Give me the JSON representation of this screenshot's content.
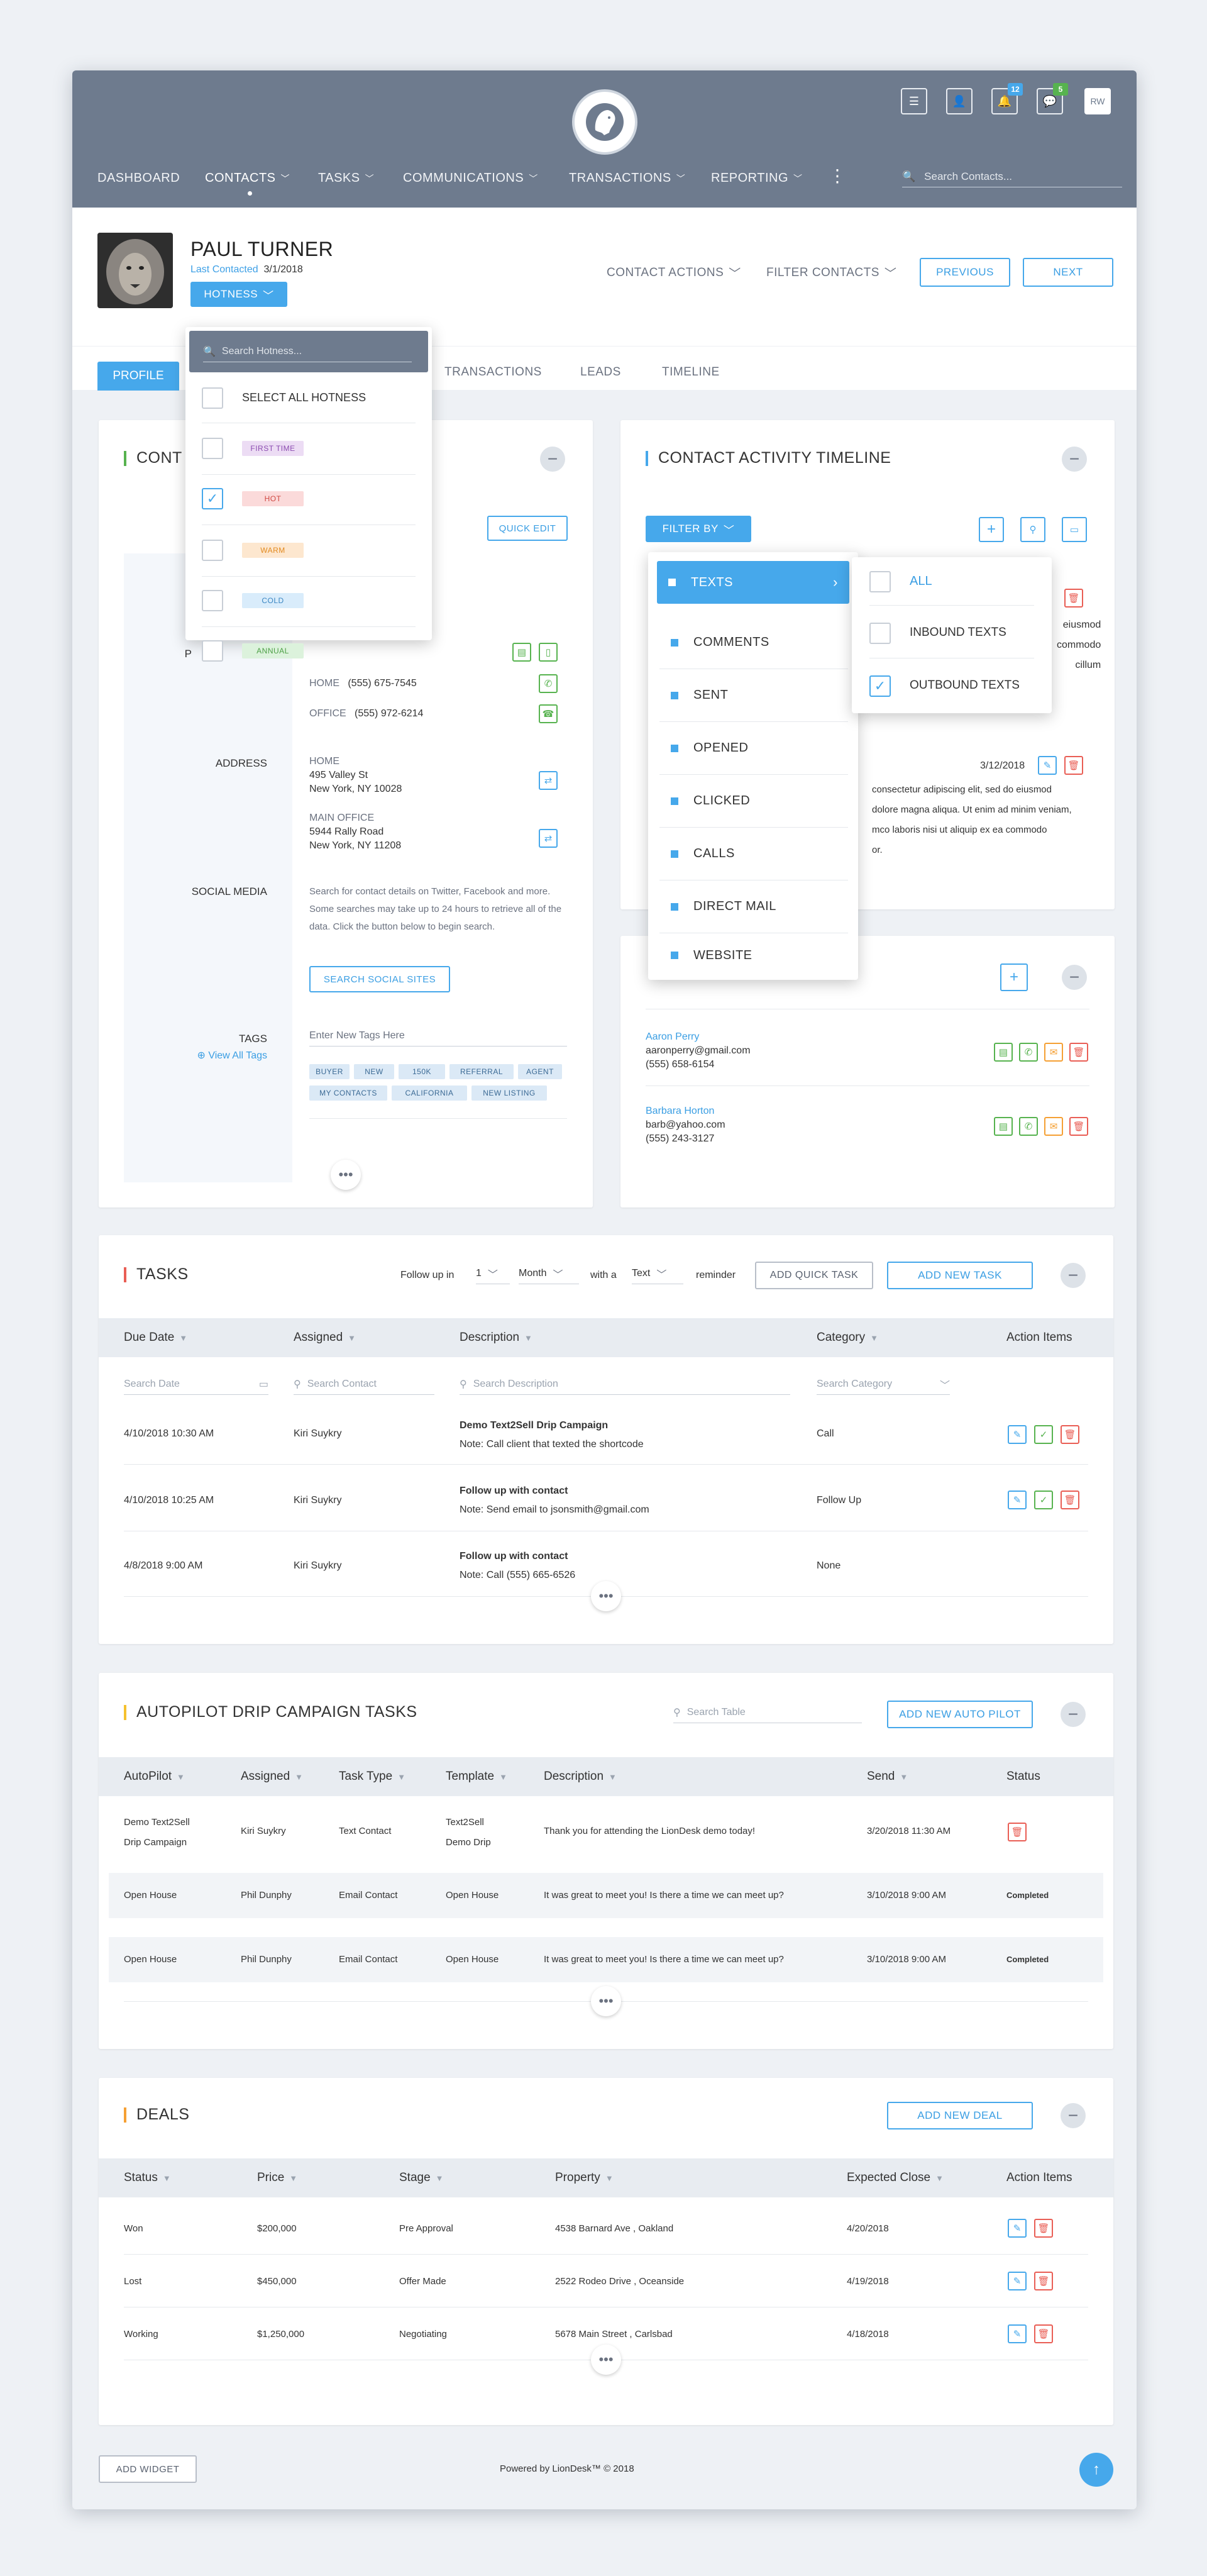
{
  "topbar": {
    "nav": [
      {
        "label": "DASHBOARD"
      },
      {
        "label": "CONTACTS"
      },
      {
        "label": "TASKS"
      },
      {
        "label": "COMMUNICATIONS"
      },
      {
        "label": "TRANSACTIONS"
      },
      {
        "label": "REPORTING"
      }
    ],
    "search_placeholder": "Search Contacts...",
    "notifications_count": "12",
    "messages_count": "5",
    "user_initials": "RW"
  },
  "contact": {
    "name": "PAUL TURNER",
    "last_contacted_label": "Last Contacted",
    "last_contacted_date": "3/1/2018",
    "hotness_button": "HOTNESS",
    "contact_actions": "CONTACT ACTIONS",
    "filter_contacts": "FILTER CONTACTS",
    "previous": "PREVIOUS",
    "next": "NEXT"
  },
  "tabs": [
    "PROFILE",
    "TRANSACTIONS",
    "LEADS",
    "TIMELINE"
  ],
  "hotness_dropdown": {
    "search_placeholder": "Search Hotness...",
    "select_all": "SELECT ALL HOTNESS",
    "options": [
      {
        "label": "FIRST TIME",
        "checked": false
      },
      {
        "label": "HOT",
        "checked": true
      },
      {
        "label": "WARM",
        "checked": false
      },
      {
        "label": "COLD",
        "checked": false
      },
      {
        "label": "ANNUAL",
        "checked": false
      }
    ]
  },
  "contact_card": {
    "title_partial": "CONT",
    "quick_edit": "QUICK EDIT",
    "phone_label_partial": "P",
    "phones": [
      {
        "type": "HOME",
        "number": "(555) 675-7545"
      },
      {
        "type": "OFFICE",
        "number": "(555) 972-6214"
      }
    ],
    "address_label": "ADDRESS",
    "addresses": [
      {
        "type": "HOME",
        "line1": "495 Valley St",
        "line2": "New York, NY 10028"
      },
      {
        "type": "MAIN OFFICE",
        "line1": "5944 Rally Road",
        "line2": "New York, NY 11208"
      }
    ],
    "social_label": "SOCIAL MEDIA",
    "social_text": "Search for contact details on Twitter, Facebook and more. Some searches may take up to 24 hours to retrieve all of the data. Click the button below to begin search.",
    "social_button": "SEARCH SOCIAL SITES",
    "tags_label": "TAGS",
    "view_all_tags": "View All Tags",
    "tags_placeholder": "Enter New Tags Here",
    "tags": [
      "BUYER",
      "NEW",
      "150K",
      "REFERRAL",
      "AGENT",
      "MY CONTACTS",
      "CALIFORNIA",
      "NEW LISTING"
    ]
  },
  "timeline": {
    "title": "CONTACT ACTIVITY TIMELINE",
    "filter_by": "FILTER BY",
    "filter_items": [
      "TEXTS",
      "COMMENTS",
      "SENT",
      "OPENED",
      "CLICKED",
      "CALLS",
      "DIRECT MAIL",
      "WEBSITE"
    ],
    "sub_items": [
      {
        "label": "ALL",
        "checked": false
      },
      {
        "label": "INBOUND TEXTS",
        "checked": false
      },
      {
        "label": "OUTBOUND TEXTS",
        "checked": true
      }
    ],
    "frag1": [
      "eiusmod",
      "commodo",
      "cillum"
    ],
    "date2": "3/12/2018",
    "frag2": [
      "consectetur adipiscing elit, sed do eiusmod",
      "dolore magna aliqua. Ut enim ad minim veniam,",
      "mco laboris nisi ut aliquip ex ea commodo",
      "or."
    ]
  },
  "associated": {
    "people": [
      {
        "name": "Aaron Perry",
        "email": "aaronperry@gmail.com",
        "phone": "(555) 658-6154"
      },
      {
        "name": "Barbara Horton",
        "email": "barb@yahoo.com",
        "phone": "(555) 243-3127"
      }
    ]
  },
  "tasks": {
    "title": "TASKS",
    "follow_up": "Follow up in",
    "num": "1",
    "unit": "Month",
    "with_a": "with a",
    "kind": "Text",
    "reminder": "reminder",
    "add_quick": "ADD QUICK TASK",
    "add_new": "ADD NEW TASK",
    "headers": [
      "Due Date",
      "Assigned",
      "Description",
      "Category",
      "Action Items"
    ],
    "search": {
      "date": "Search Date",
      "contact": "Search Contact",
      "description": "Search Description",
      "category": "Search Category"
    },
    "rows": [
      {
        "date": "4/10/2018  10:30 AM",
        "assigned": "Kiri Suykry",
        "desc_title": "Demo Text2Sell Drip Campaign",
        "desc_note": "Note: Call client that texted the shortcode",
        "category": "Call"
      },
      {
        "date": "4/10/2018  10:25 AM",
        "assigned": "Kiri Suykry",
        "desc_title": "Follow up with contact",
        "desc_note": "Note: Send email to jsonsmith@gmail.com",
        "category": "Follow Up"
      },
      {
        "date": "4/8/2018  9:00 AM",
        "assigned": "Kiri Suykry",
        "desc_title": "Follow up with contact",
        "desc_note": "Note: Call (555) 665-6526",
        "category": "None"
      }
    ]
  },
  "autopilot": {
    "title": "AUTOPILOT DRIP CAMPAIGN TASKS",
    "search_placeholder": "Search Table",
    "add_new": "ADD NEW AUTO PILOT",
    "headers": [
      "AutoPilot",
      "Assigned",
      "Task Type",
      "Template",
      "Description",
      "Send",
      "Status"
    ],
    "rows": [
      {
        "autopilot1": "Demo Text2Sell",
        "autopilot2": "Drip Campaign",
        "assigned": "Kiri Suykry",
        "type": "Text Contact",
        "template1": "Text2Sell",
        "template2": "Demo Drip",
        "description": "Thank you for attending the LionDesk demo today!",
        "send": "3/20/2018  11:30 AM",
        "status": ""
      },
      {
        "autopilot1": "Open House",
        "autopilot2": "",
        "assigned": "Phil Dunphy",
        "type": "Email Contact",
        "template1": "Open House",
        "template2": "",
        "description": "It was great to meet you! Is there a time we can meet up?",
        "send": "3/10/2018  9:00 AM",
        "status": "Completed"
      },
      {
        "autopilot1": "Open House",
        "autopilot2": "",
        "assigned": "Phil Dunphy",
        "type": "Email Contact",
        "template1": "Open House",
        "template2": "",
        "description": "It was great to meet you! Is there a time we can meet up?",
        "send": "3/10/2018  9:00 AM",
        "status": "Completed"
      }
    ]
  },
  "deals": {
    "title": "DEALS",
    "add_new": "ADD NEW DEAL",
    "headers": [
      "Status",
      "Price",
      "Stage",
      "Property",
      "Expected Close",
      "Action Items"
    ],
    "rows": [
      {
        "status": "Won",
        "price": "$200,000",
        "stage": "Pre Approval",
        "property": "4538 Barnard Ave , Oakland",
        "close": "4/20/2018"
      },
      {
        "status": "Lost",
        "price": "$450,000",
        "stage": "Offer Made",
        "property": "2522 Rodeo Drive , Oceanside",
        "close": "4/19/2018"
      },
      {
        "status": "Working",
        "price": "$1,250,000",
        "stage": "Negotiating",
        "property": "5678 Main Street , Carlsbad",
        "close": "4/18/2018"
      }
    ]
  },
  "footer": {
    "add_widget": "ADD WIDGET",
    "powered": "Powered by LionDesk™ © 2018"
  },
  "colors": {
    "accent": "#46a8eb",
    "topbar": "#6e7b8e",
    "hot": "#fbdada",
    "first_time": "#ecdcf4",
    "warm": "#fde7cf",
    "cold": "#d9ecfb",
    "annual": "#dcf2dc"
  }
}
